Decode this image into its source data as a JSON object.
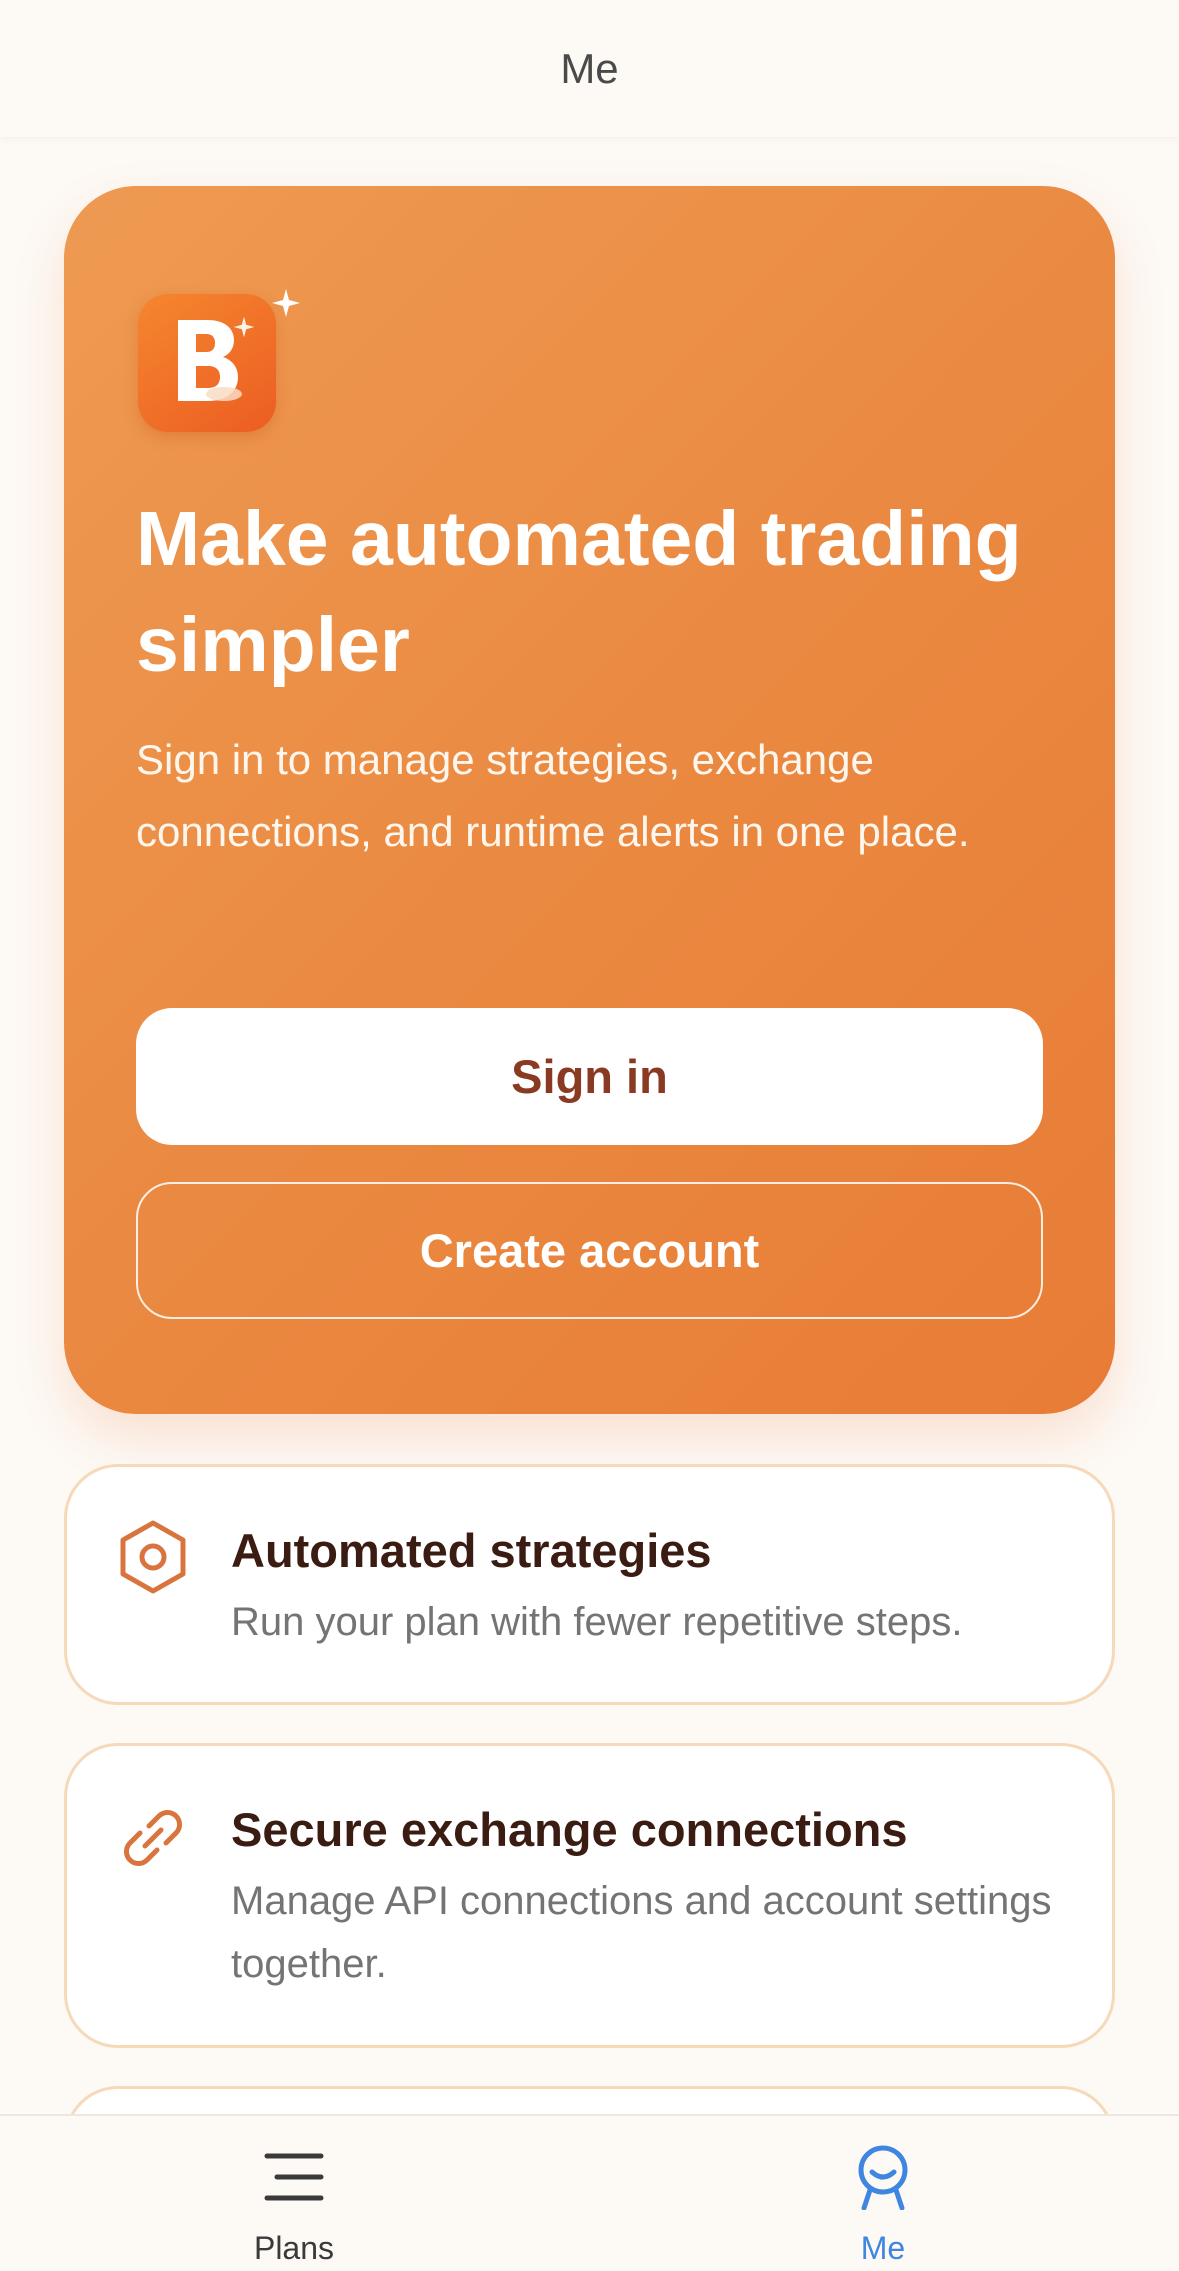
{
  "header": {
    "title": "Me"
  },
  "hero": {
    "title": "Make automated trading simpler",
    "subtitle": "Sign in to manage strategies, exchange connections, and runtime alerts in one place.",
    "signin_label": "Sign in",
    "create_label": "Create account"
  },
  "features": [
    {
      "title": "Automated strategies",
      "description": "Run your plan with fewer repetitive steps.",
      "icon": "hexagon-icon"
    },
    {
      "title": "Secure exchange connections",
      "description": "Manage API connections and account settings together.",
      "icon": "link-icon"
    }
  ],
  "tabs": [
    {
      "label": "Plans",
      "icon": "list-icon",
      "active": false
    },
    {
      "label": "Me",
      "icon": "person-icon",
      "active": true
    }
  ],
  "colors": {
    "accent": "#ea8840",
    "active_tab": "#3f86e0",
    "inactive_tab": "#3a3a3a",
    "card_border": "#f6d9b9",
    "icon": "#d9743e"
  }
}
